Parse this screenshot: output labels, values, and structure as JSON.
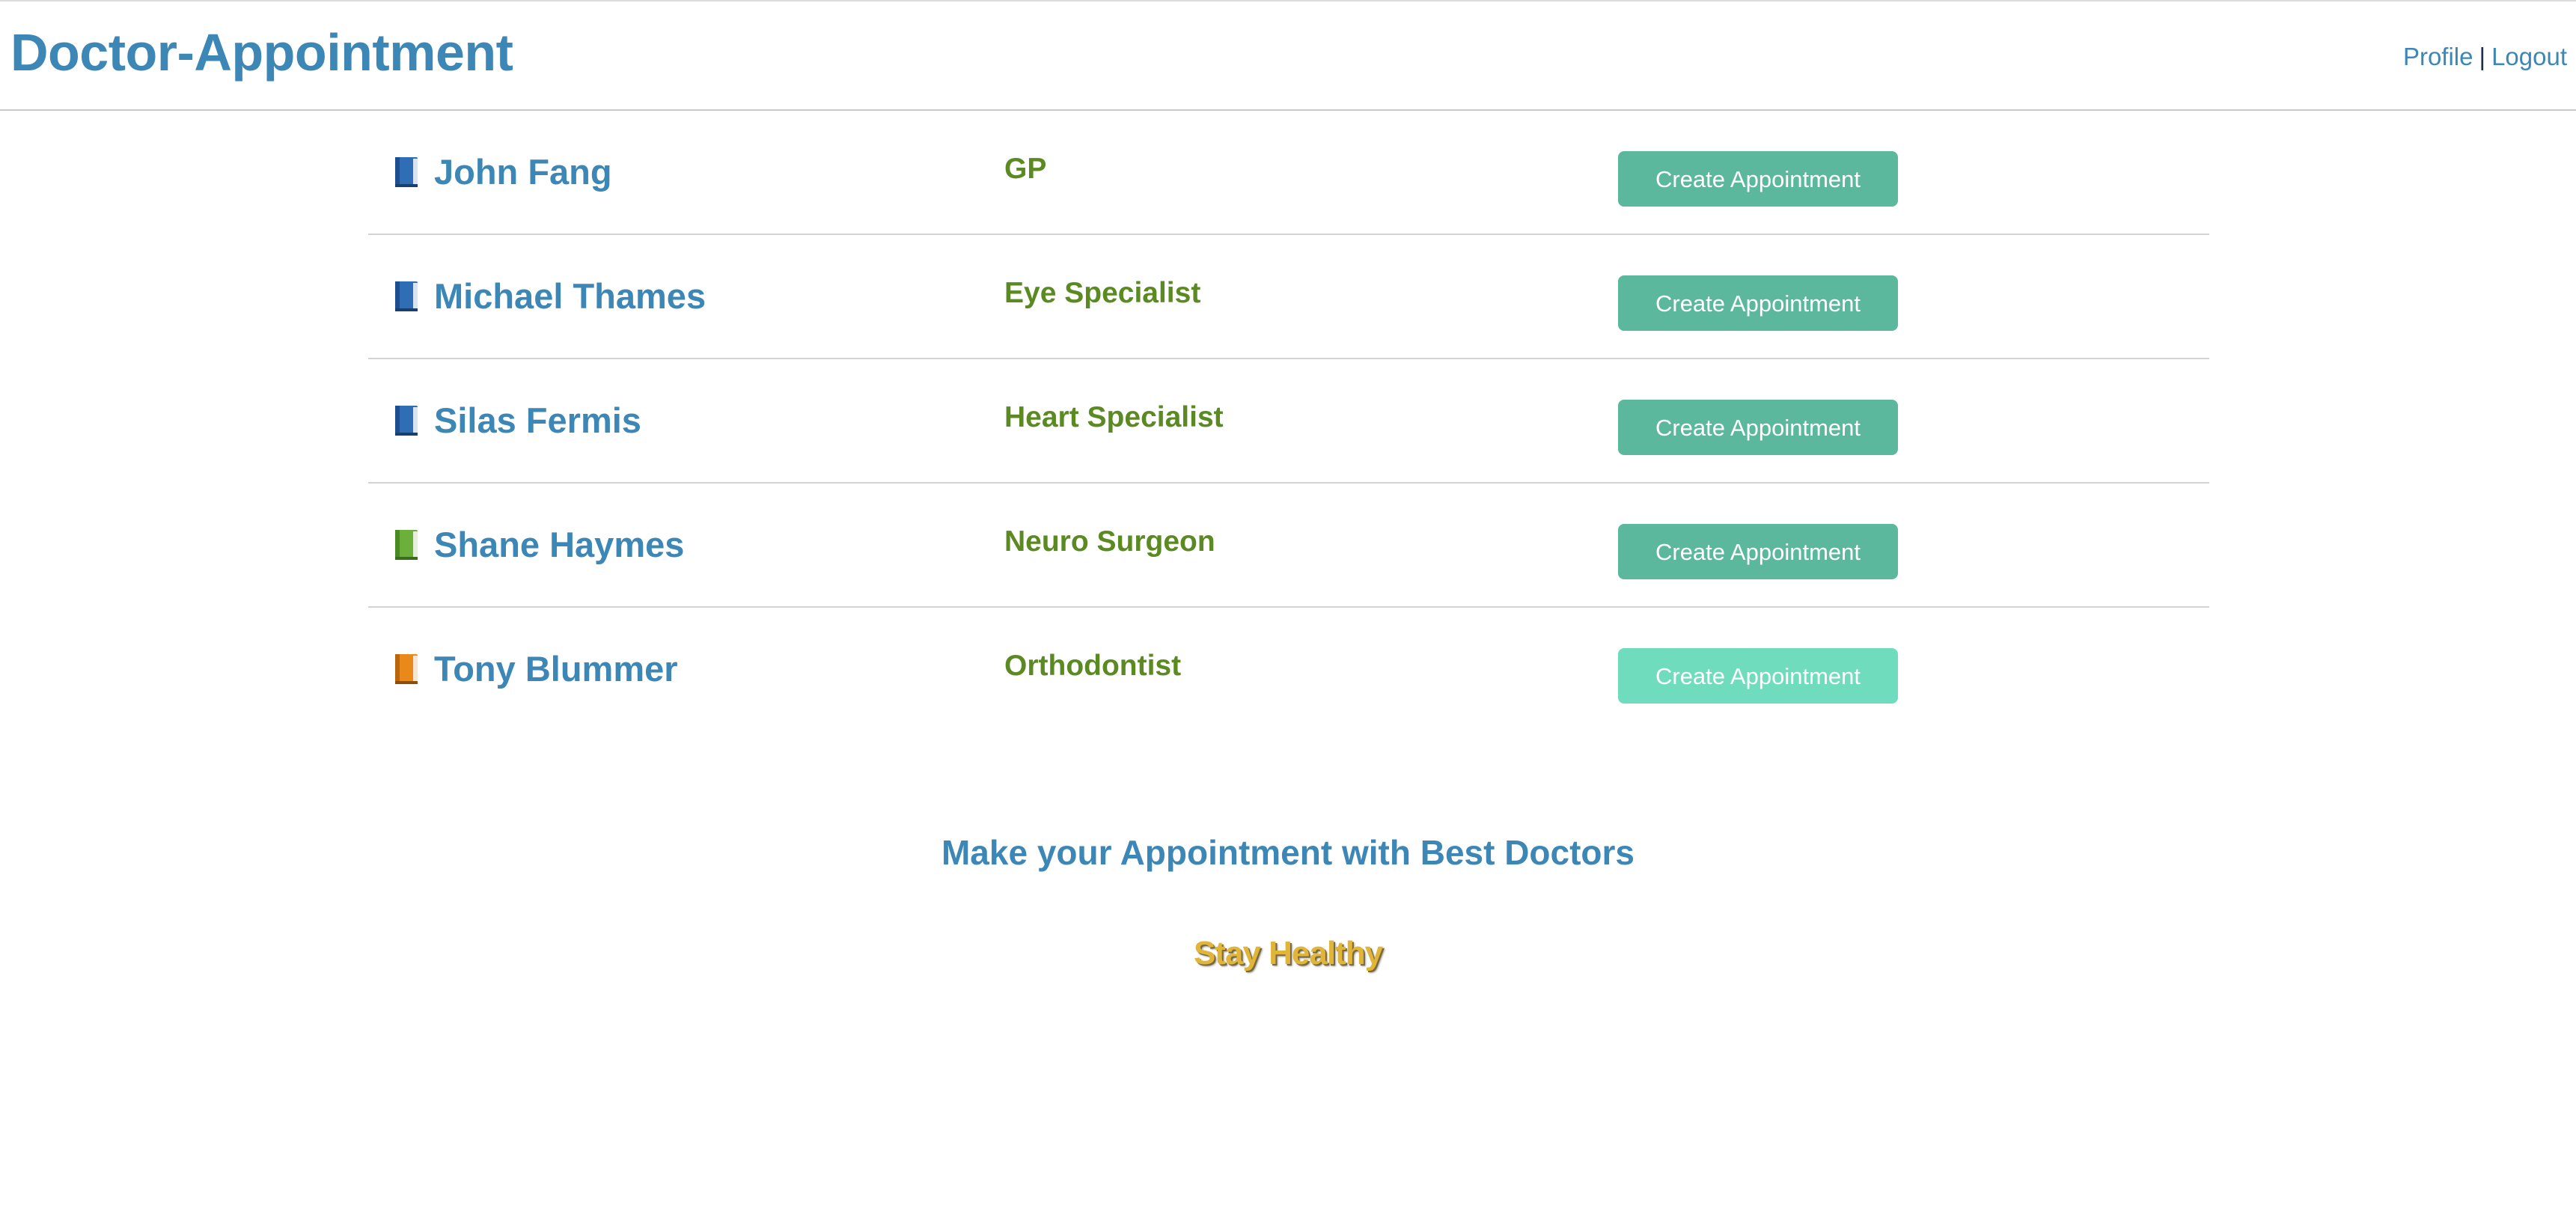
{
  "header": {
    "title": "Doctor-Appointment",
    "nav": {
      "profile": "Profile",
      "separator": "|",
      "logout": "Logout"
    }
  },
  "doctors": [
    {
      "name": "John Fang",
      "specialty": "GP",
      "button": "Create Appointment",
      "icon": "blue-book-icon",
      "icon_color": "#2f6db5"
    },
    {
      "name": "Michael Thames",
      "specialty": "Eye Specialist",
      "button": "Create Appointment",
      "icon": "blue-book-icon",
      "icon_color": "#2f6db5"
    },
    {
      "name": "Silas Fermis",
      "specialty": "Heart Specialist",
      "button": "Create Appointment",
      "icon": "blue-book-icon",
      "icon_color": "#2f6db5"
    },
    {
      "name": "Shane Haymes",
      "specialty": "Neuro Surgeon",
      "button": "Create Appointment",
      "icon": "green-book-icon",
      "icon_color": "#6bb03a"
    },
    {
      "name": "Tony Blummer",
      "specialty": "Orthodontist",
      "button": "Create Appointment",
      "icon": "orange-book-icon",
      "icon_color": "#e8891a"
    }
  ],
  "footer": {
    "tagline": "Make your Appointment with Best Doctors",
    "slogan": "Stay Healthy"
  },
  "colors": {
    "brand": "#3d87b6",
    "specialty": "#5b8a22",
    "button": "#5cb89c",
    "button_hover": "#6fdcbd",
    "slogan": "#e0b53a"
  }
}
